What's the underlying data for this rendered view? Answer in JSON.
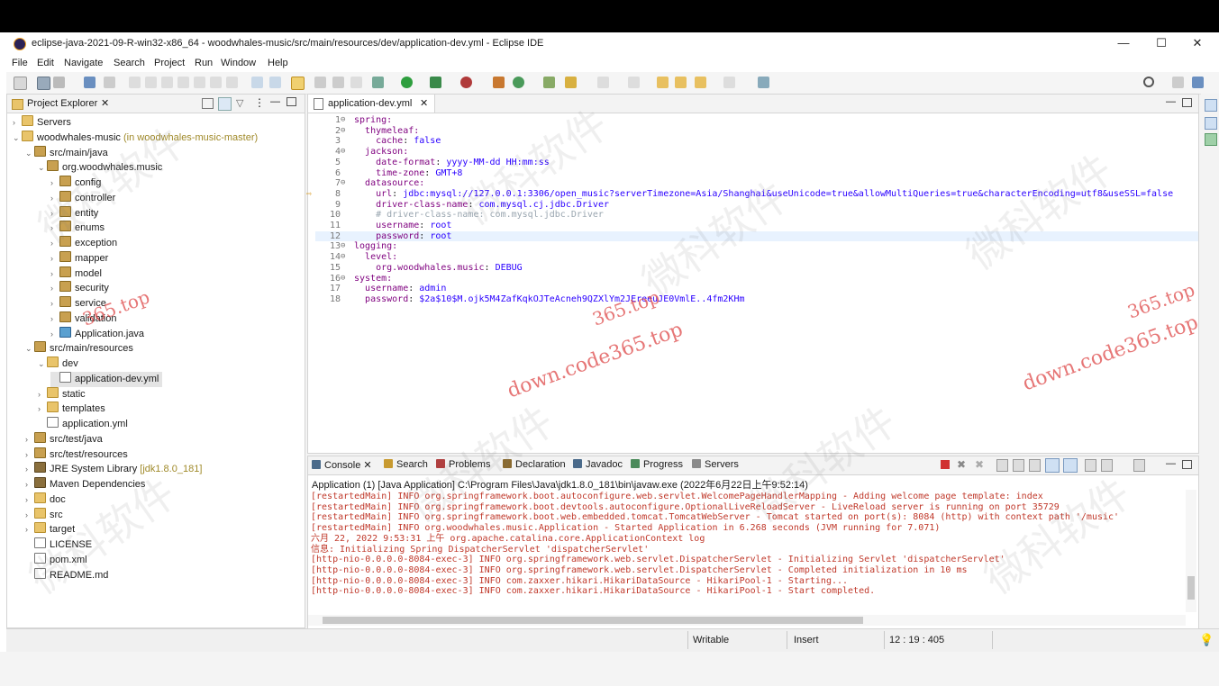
{
  "window": {
    "title": "eclipse-java-2021-09-R-win32-x86_64 - woodwhales-music/src/main/resources/dev/application-dev.yml - Eclipse IDE",
    "minimize": "—",
    "maximize": "☐",
    "close": "✕"
  },
  "menu": [
    "File",
    "Edit",
    "Navigate",
    "Search",
    "Project",
    "Run",
    "Window",
    "Help"
  ],
  "explorer": {
    "tab": "Project Explorer",
    "items": [
      {
        "label": "Servers",
        "indent": 0,
        "icon": "folder",
        "tw": "›"
      },
      {
        "label": "woodwhales-music",
        "extra": " (in woodwhales-music-master)",
        "indent": 0,
        "icon": "folder",
        "tw": "⌄"
      },
      {
        "label": "src/main/java",
        "indent": 1,
        "icon": "pkg",
        "tw": "⌄"
      },
      {
        "label": "org.woodwhales.music",
        "indent": 2,
        "icon": "pkg",
        "tw": "⌄"
      },
      {
        "label": "config",
        "indent": 3,
        "icon": "pkg",
        "tw": "›"
      },
      {
        "label": "controller",
        "indent": 3,
        "icon": "pkg",
        "tw": "›"
      },
      {
        "label": "entity",
        "indent": 3,
        "icon": "pkg",
        "tw": "›"
      },
      {
        "label": "enums",
        "indent": 3,
        "icon": "pkg",
        "tw": "›"
      },
      {
        "label": "exception",
        "indent": 3,
        "icon": "pkg",
        "tw": "›"
      },
      {
        "label": "mapper",
        "indent": 3,
        "icon": "pkg",
        "tw": "›"
      },
      {
        "label": "model",
        "indent": 3,
        "icon": "pkg",
        "tw": "›"
      },
      {
        "label": "security",
        "indent": 3,
        "icon": "pkg",
        "tw": "›"
      },
      {
        "label": "service",
        "indent": 3,
        "icon": "pkg",
        "tw": "›"
      },
      {
        "label": "validation",
        "indent": 3,
        "icon": "pkg",
        "tw": "›"
      },
      {
        "label": "Application.java",
        "indent": 3,
        "icon": "java",
        "tw": "›"
      },
      {
        "label": "src/main/resources",
        "indent": 1,
        "icon": "pkg",
        "tw": "⌄"
      },
      {
        "label": "dev",
        "indent": 2,
        "icon": "folder",
        "tw": "⌄"
      },
      {
        "label": "application-dev.yml",
        "indent": 3,
        "icon": "file",
        "tw": "",
        "selected": true
      },
      {
        "label": "static",
        "indent": 2,
        "icon": "folder",
        "tw": "›"
      },
      {
        "label": "templates",
        "indent": 2,
        "icon": "folder",
        "tw": "›"
      },
      {
        "label": "application.yml",
        "indent": 2,
        "icon": "file",
        "tw": ""
      },
      {
        "label": "src/test/java",
        "indent": 1,
        "icon": "pkg",
        "tw": "›"
      },
      {
        "label": "src/test/resources",
        "indent": 1,
        "icon": "pkg",
        "tw": "›"
      },
      {
        "label": "JRE System Library",
        "extra": " [jdk1.8.0_181]",
        "indent": 1,
        "icon": "jar",
        "tw": "›"
      },
      {
        "label": "Maven Dependencies",
        "indent": 1,
        "icon": "jar",
        "tw": "›"
      },
      {
        "label": "doc",
        "indent": 1,
        "icon": "folder",
        "tw": "›"
      },
      {
        "label": "src",
        "indent": 1,
        "icon": "folder",
        "tw": "›"
      },
      {
        "label": "target",
        "indent": 1,
        "icon": "folder",
        "tw": "›"
      },
      {
        "label": "LICENSE",
        "indent": 1,
        "icon": "file",
        "tw": ""
      },
      {
        "label": "pom.xml",
        "indent": 1,
        "icon": "file",
        "tw": ""
      },
      {
        "label": "README.md",
        "indent": 1,
        "icon": "file",
        "tw": ""
      }
    ]
  },
  "editor": {
    "tab": "application-dev.yml",
    "lines": [
      {
        "n": "1",
        "fold": true,
        "parts": [
          [
            "key",
            "spring:"
          ]
        ]
      },
      {
        "n": "2",
        "fold": true,
        "parts": [
          [
            "",
            "  "
          ],
          [
            "key",
            "thymeleaf:"
          ]
        ]
      },
      {
        "n": "3",
        "parts": [
          [
            "",
            "    "
          ],
          [
            "key",
            "cache"
          ],
          [
            "",
            ": "
          ],
          [
            "val",
            "false"
          ]
        ]
      },
      {
        "n": "4",
        "fold": true,
        "parts": [
          [
            "",
            "  "
          ],
          [
            "key",
            "jackson:"
          ]
        ]
      },
      {
        "n": "5",
        "parts": [
          [
            "",
            "    "
          ],
          [
            "key",
            "date-format"
          ],
          [
            "",
            ": "
          ],
          [
            "val",
            "yyyy-MM-dd HH:mm:ss"
          ]
        ]
      },
      {
        "n": "6",
        "parts": [
          [
            "",
            "    "
          ],
          [
            "key",
            "time-zone"
          ],
          [
            "",
            ": "
          ],
          [
            "val",
            "GMT+8"
          ]
        ]
      },
      {
        "n": "7",
        "fold": true,
        "parts": [
          [
            "",
            "  "
          ],
          [
            "key",
            "datasource:"
          ]
        ]
      },
      {
        "n": "8",
        "parts": [
          [
            "",
            "    "
          ],
          [
            "key",
            "url"
          ],
          [
            "",
            ": "
          ],
          [
            "val",
            "jdbc:mysql://127.0.0.1:3306/open_music?serverTimezone=Asia/Shanghai&useUnicode=true&allowMultiQueries=true&characterEncoding=utf8&useSSL=false"
          ]
        ]
      },
      {
        "n": "9",
        "parts": [
          [
            "",
            "    "
          ],
          [
            "key",
            "driver-class-name"
          ],
          [
            "",
            ": "
          ],
          [
            "val",
            "com.mysql.cj.jdbc.Driver"
          ]
        ]
      },
      {
        "n": "10",
        "parts": [
          [
            "",
            "    "
          ],
          [
            "cmt",
            "# driver-class-name: com.mysql.jdbc.Driver"
          ]
        ]
      },
      {
        "n": "11",
        "parts": [
          [
            "",
            "    "
          ],
          [
            "key",
            "username"
          ],
          [
            "",
            ": "
          ],
          [
            "val",
            "root"
          ]
        ]
      },
      {
        "n": "12",
        "parts": [
          [
            "",
            "    "
          ],
          [
            "key",
            "password"
          ],
          [
            "",
            ": "
          ],
          [
            "val",
            "root"
          ]
        ]
      },
      {
        "n": "13",
        "fold": true,
        "parts": [
          [
            "key",
            "logging:"
          ]
        ]
      },
      {
        "n": "14",
        "fold": true,
        "parts": [
          [
            "",
            "  "
          ],
          [
            "key",
            "level:"
          ]
        ]
      },
      {
        "n": "15",
        "parts": [
          [
            "",
            "    "
          ],
          [
            "key",
            "org.woodwhales.music"
          ],
          [
            "",
            ": "
          ],
          [
            "val",
            "DEBUG"
          ]
        ]
      },
      {
        "n": "16",
        "fold": true,
        "parts": [
          [
            "key",
            "system:"
          ]
        ]
      },
      {
        "n": "17",
        "parts": [
          [
            "",
            "  "
          ],
          [
            "key",
            "username"
          ],
          [
            "",
            ": "
          ],
          [
            "val",
            "admin"
          ]
        ]
      },
      {
        "n": "18",
        "parts": [
          [
            "",
            "  "
          ],
          [
            "key",
            "password"
          ],
          [
            "",
            ": "
          ],
          [
            "val",
            "$2a$10$M.ojk5M4ZafKqkOJTeAcneh9QZXlYm2JEreeuJE0VmlE..4fm2KHm"
          ]
        ]
      }
    ]
  },
  "console": {
    "tabs": [
      "Console",
      "Search",
      "Problems",
      "Declaration",
      "Javadoc",
      "Progress",
      "Servers"
    ],
    "header": "Application (1) [Java Application] C:\\Program Files\\Java\\jdk1.8.0_181\\bin\\javaw.exe  (2022年6月22日上午9:52:14)",
    "lines": [
      "[restartedMain] INFO org.springframework.boot.autoconfigure.web.servlet.WelcomePageHandlerMapping - Adding welcome page template: index",
      "[restartedMain] INFO org.springframework.boot.devtools.autoconfigure.OptionalLiveReloadServer - LiveReload server is running on port 35729",
      "[restartedMain] INFO org.springframework.boot.web.embedded.tomcat.TomcatWebServer - Tomcat started on port(s): 8084 (http) with context path '/music'",
      "[restartedMain] INFO org.woodwhales.music.Application - Started Application in 6.268 seconds (JVM running for 7.071)",
      "六月 22, 2022 9:53:31 上午 org.apache.catalina.core.ApplicationContext log",
      "信息: Initializing Spring DispatcherServlet 'dispatcherServlet'",
      "[http-nio-0.0.0.0-8084-exec-3] INFO org.springframework.web.servlet.DispatcherServlet - Initializing Servlet 'dispatcherServlet'",
      "[http-nio-0.0.0.0-8084-exec-3] INFO org.springframework.web.servlet.DispatcherServlet - Completed initialization in 10 ms",
      "[http-nio-0.0.0.0-8084-exec-3] INFO com.zaxxer.hikari.HikariDataSource - HikariPool-1 - Starting...",
      "[http-nio-0.0.0.0-8084-exec-3] INFO com.zaxxer.hikari.HikariDataSource - HikariPool-1 - Start completed."
    ]
  },
  "status": {
    "writable": "Writable",
    "insert": "Insert",
    "position": "12 : 19 : 405"
  },
  "watermarks": {
    "site": "down.code365.top",
    "site_short": "365.top",
    "cn": "微科软件"
  },
  "colors": {
    "accent": "#2a00ff",
    "key": "#7f007f",
    "console_text": "#c0392b"
  }
}
